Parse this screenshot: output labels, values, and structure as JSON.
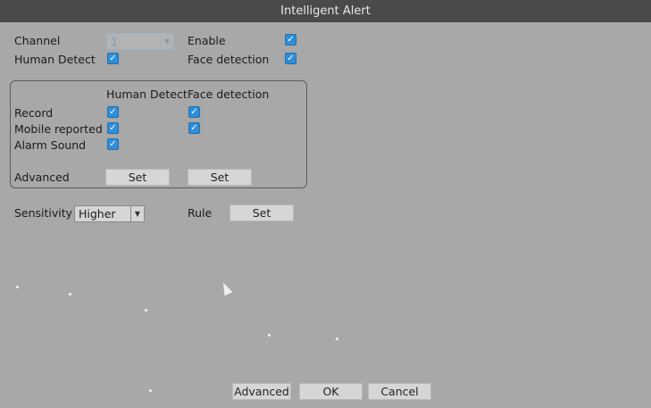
{
  "window": {
    "title": "Intelligent Alert"
  },
  "general": {
    "channel_label": "Channel",
    "channel_value": "1",
    "enable_label": "Enable",
    "human_detect_label": "Human Detect",
    "face_detection_label": "Face detection"
  },
  "actions": {
    "col_human": "Human Detect",
    "col_face": "Face detection",
    "record_label": "Record",
    "mobile_label": "Mobile reported",
    "alarm_label": "Alarm Sound",
    "advanced_label": "Advanced",
    "set_human": "Set",
    "set_face": "Set"
  },
  "sensitivity": {
    "label": "Sensitivity",
    "value": "Higher",
    "rule_label": "Rule",
    "rule_set": "Set"
  },
  "footer": {
    "advanced": "Advanced",
    "ok": "OK",
    "cancel": "Cancel"
  },
  "colors": {
    "checkbox": "#2f8fd8",
    "titlebar": "#4a4a4a",
    "panel": "#a8a8a8"
  }
}
